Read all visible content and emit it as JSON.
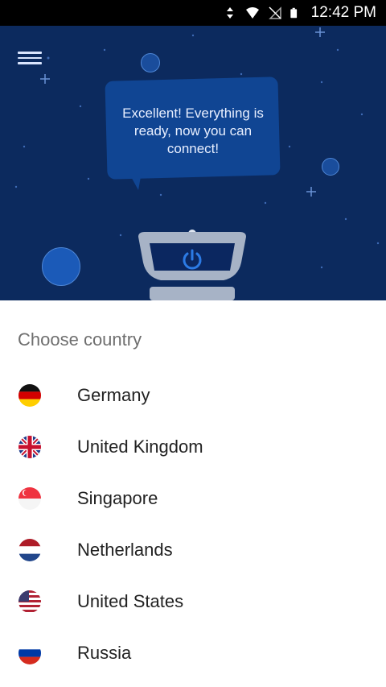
{
  "status_bar": {
    "time": "12:42 PM",
    "icons": [
      "data-arrows-icon",
      "wifi-icon",
      "no-sim-icon",
      "battery-icon"
    ]
  },
  "hero": {
    "message": "Excellent! Everything is ready, now you can connect!",
    "menu_icon": "hamburger-menu-icon",
    "power_icon": "power-icon"
  },
  "country_list": {
    "title": "Choose country",
    "items": [
      {
        "name": "Germany",
        "flag": "germany-flag-icon"
      },
      {
        "name": "United Kingdom",
        "flag": "uk-flag-icon"
      },
      {
        "name": "Singapore",
        "flag": "singapore-flag-icon"
      },
      {
        "name": "Netherlands",
        "flag": "netherlands-flag-icon"
      },
      {
        "name": "United States",
        "flag": "us-flag-icon"
      },
      {
        "name": "Russia",
        "flag": "russia-flag-icon"
      }
    ]
  },
  "colors": {
    "hero_bg": "#0c2a5e",
    "bubble": "#104593",
    "accent": "#1976d2"
  }
}
